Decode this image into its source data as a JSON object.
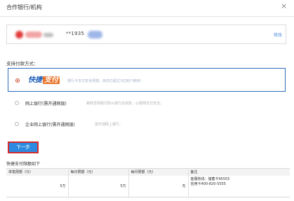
{
  "dialog": {
    "title": "合作银行/机构",
    "close_label": "×"
  },
  "bank": {
    "card_number": "**1935",
    "modify_label": "修改"
  },
  "payment": {
    "section_title": "支持付款方式：",
    "options": [
      {
        "logo_part1": "快捷",
        "logo_part2": "支付",
        "description": "银行卡支付安全便捷，目前已超过3亿用户使用！",
        "selected": true
      },
      {
        "label": "网上银行(需开通网银)",
        "description": "跳转至网银付款从银行处收款，以银网支付安全。",
        "selected": false
      },
      {
        "label": "企业网上银行(需开通网银)",
        "description": "需开通网上银行。",
        "selected": false
      }
    ]
  },
  "next_button_label": "下一步",
  "limits": {
    "title": "快捷支付限额如下",
    "headers": [
      "单笔限额（元）",
      "每日限额（元）",
      "每月限额（元）",
      "备注"
    ],
    "row": [
      "5万",
      "5万",
      "无"
    ],
    "note_lines": [
      "客服热线：储蓄卡95555",
      "信用卡400-820-5555"
    ]
  },
  "colors": {
    "primary_button": "#2c8be0",
    "highlight_border": "#d42a2a",
    "selected_border": "#2f6cc0",
    "link": "#4f8fe0"
  }
}
